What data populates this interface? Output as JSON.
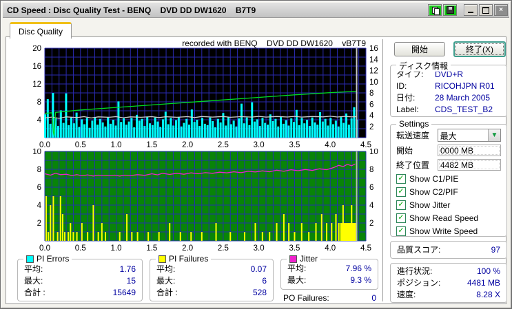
{
  "titlebar": {
    "title": "CD Speed : Disc Quality Test - BENQ    DVD DD DW1620    B7T9",
    "close_glyph": "×"
  },
  "tab": {
    "label": "Disc Quality"
  },
  "chart_header": {
    "recorded_with": "recorded with BENQ    DVD DD DW1620    vB7T9"
  },
  "buttons": {
    "start": "開始",
    "exit": "終了(X)"
  },
  "disc_info": {
    "title": "ディスク情報",
    "rows": [
      {
        "label": "タイプ:",
        "value": "DVD+R"
      },
      {
        "label": "ID:",
        "value": "RICOHJPN R01"
      },
      {
        "label": "日付:",
        "value": "28 March 2005"
      },
      {
        "label": "Label:",
        "value": "CDS_TEST_B2"
      }
    ]
  },
  "settings": {
    "title": "Settings",
    "speed_label": "転送速度",
    "speed_value": "最大",
    "start_label": "開始",
    "start_value": "0000 MB",
    "end_label": "終了位置",
    "end_value": "4482 MB",
    "checkboxes": [
      {
        "label": "Show C1/PIE",
        "checked": true
      },
      {
        "label": "Show C2/PIF",
        "checked": true
      },
      {
        "label": "Show Jitter",
        "checked": true
      },
      {
        "label": "Show Read Speed",
        "checked": true
      },
      {
        "label": "Show Write Speed",
        "checked": true
      }
    ],
    "check_glyph": "✓"
  },
  "quality": {
    "label": "品質スコア:",
    "value": "97"
  },
  "status": {
    "rows": [
      {
        "label": "進行状況:",
        "value": "100 %"
      },
      {
        "label": "ポジション:",
        "value": "4481  MB"
      },
      {
        "label": "速度:",
        "value": "8.28 X"
      }
    ]
  },
  "stats": {
    "pi_errors": {
      "title": "PI Errors",
      "swatch": "#00ffff",
      "rows": [
        {
          "label": "平均:",
          "value": "1.76"
        },
        {
          "label": "最大:",
          "value": "15"
        },
        {
          "label": "合計 :",
          "value": "15649"
        }
      ]
    },
    "pi_failures": {
      "title": "PI Failures",
      "swatch": "#ffff00",
      "rows": [
        {
          "label": "平均:",
          "value": "0.07"
        },
        {
          "label": "最大:",
          "value": "6"
        },
        {
          "label": "合計 :",
          "value": "528"
        }
      ]
    },
    "jitter": {
      "title": "Jitter",
      "swatch": "#ee22cc",
      "rows": [
        {
          "label": "平均:",
          "value": "7.96 %"
        },
        {
          "label": "最大:",
          "value": "9.3 %"
        }
      ]
    },
    "po_failures": {
      "label": "PO Failures:",
      "value": "0"
    }
  },
  "chart_data": [
    {
      "type": "area",
      "title": "PI Errors / speed (top graph)",
      "xlim": [
        0,
        4.5
      ],
      "x_ticks": [
        {
          "v": 0,
          "label": "0.0"
        },
        {
          "v": 0.5,
          "label": "0.5"
        },
        {
          "v": 1,
          "label": "1.0"
        },
        {
          "v": 1.5,
          "label": "1.5"
        },
        {
          "v": 2,
          "label": "2.0"
        },
        {
          "v": 2.5,
          "label": "2.5"
        },
        {
          "v": 3,
          "label": "3.0"
        },
        {
          "v": 3.5,
          "label": "3.5"
        },
        {
          "v": 4,
          "label": "4.0"
        },
        {
          "v": 4.5,
          "label": "4.5"
        }
      ],
      "left_ymax": 20,
      "left_ticks": [
        {
          "v": 20,
          "label": "20"
        },
        {
          "v": 16,
          "label": "16"
        },
        {
          "v": 12,
          "label": "12"
        },
        {
          "v": 8,
          "label": "8"
        },
        {
          "v": 4,
          "label": "4"
        }
      ],
      "right_ymax": 16,
      "right_ticks": [
        {
          "v": 16,
          "label": "16"
        },
        {
          "v": 14,
          "label": "14"
        },
        {
          "v": 12,
          "label": "12"
        },
        {
          "v": 10,
          "label": "10"
        },
        {
          "v": 8,
          "label": "8"
        },
        {
          "v": 6,
          "label": "6"
        },
        {
          "v": 4,
          "label": "4"
        },
        {
          "v": 2,
          "label": "2"
        }
      ],
      "grid_x_step": 0.1,
      "grid_y_step": 2,
      "bg": "#000000",
      "grid_color": "#2a2ab0",
      "cursor_x": 4.37,
      "cursor_color": "#c8c8c8",
      "series": [
        {
          "name": "pi-errors",
          "type": "bars-dense",
          "axis": "left",
          "color": "#00ffff",
          "x_step": 0.0367,
          "heights": [
            5.2,
            8.6,
            3.1,
            10,
            4.4,
            2.6,
            6.1,
            3.3,
            9.9,
            2.8,
            4.5,
            3.2,
            5.6,
            2.4,
            4.1,
            3.0,
            4.4,
            2.2,
            3.8,
            4.5,
            2.9,
            4.2,
            3.4,
            2.5,
            4.6,
            3.1,
            4.0,
            2.7,
            8.1,
            3.5,
            4.3,
            2.9,
            3.6,
            4.4,
            2.3,
            5.1,
            3.8,
            4.2,
            2.6,
            4.7,
            3.2,
            2.8,
            4.5,
            3.6,
            2.4,
            4.1,
            5.8,
            3.0,
            4.4,
            2.7,
            3.9,
            4.6,
            2.5,
            3.3,
            4.2,
            2.9,
            6.3,
            3.5,
            4.0,
            2.6,
            4.4,
            3.1,
            2.8,
            4.5,
            3.7,
            2.3,
            4.2,
            3.4,
            5.5,
            2.7,
            4.6,
            3.0,
            3.8,
            2.5,
            4.3,
            7.6,
            3.2,
            4.5,
            2.8,
            7.9,
            3.6,
            4.1,
            2.6,
            4.4,
            3.3,
            2.9,
            5.2,
            3.7,
            4.2,
            2.5,
            4.6,
            3.1,
            3.9,
            2.7,
            4.3,
            3.5,
            6.2,
            2.8,
            4.4,
            3.2,
            4.0,
            2.6,
            4.5,
            3.4,
            2.9,
            5.7,
            3.6,
            4.2,
            2.7,
            4.4,
            3.0,
            3.8,
            2.5,
            4.6,
            3.3,
            5.4,
            2.9,
            4.3,
            6.8,
            4.0
          ]
        },
        {
          "name": "write-speed",
          "type": "line",
          "axis": "left",
          "color": "#cfcfcf",
          "data": [
            [
              0,
              4.4
            ],
            [
              0.1,
              4.6
            ],
            [
              0.2,
              4.3
            ],
            [
              0.3,
              4.65
            ],
            [
              0.45,
              4.5
            ],
            [
              0.55,
              4.7
            ],
            [
              0.65,
              4.4
            ],
            [
              0.75,
              4.65
            ],
            [
              0.9,
              4.55
            ],
            [
              1.0,
              4.7
            ],
            [
              1.1,
              4.45
            ],
            [
              1.2,
              4.65
            ],
            [
              1.35,
              4.55
            ],
            [
              1.5,
              4.7
            ],
            [
              1.6,
              4.5
            ],
            [
              1.7,
              4.68
            ],
            [
              1.85,
              4.55
            ],
            [
              2.0,
              4.7
            ],
            [
              2.1,
              4.5
            ],
            [
              2.2,
              4.72
            ],
            [
              2.35,
              4.6
            ],
            [
              2.5,
              4.72
            ],
            [
              2.6,
              4.55
            ],
            [
              2.75,
              4.7
            ],
            [
              2.9,
              4.6
            ],
            [
              3.0,
              4.75
            ],
            [
              3.1,
              4.6
            ],
            [
              3.25,
              4.72
            ],
            [
              3.4,
              4.62
            ],
            [
              3.5,
              4.75
            ],
            [
              3.6,
              4.6
            ],
            [
              3.75,
              4.72
            ],
            [
              3.9,
              4.65
            ],
            [
              4.0,
              4.78
            ],
            [
              4.1,
              4.62
            ],
            [
              4.2,
              4.75
            ],
            [
              4.3,
              4.65
            ],
            [
              4.37,
              4.7
            ]
          ]
        },
        {
          "name": "read-speed",
          "type": "line",
          "axis": "right",
          "color": "#00dd22",
          "data": [
            [
              0,
              4.35
            ],
            [
              0.1,
              4.45
            ],
            [
              0.12,
              1.0
            ],
            [
              0.13,
              0.35
            ],
            [
              0.15,
              4.5
            ],
            [
              0.5,
              4.95
            ],
            [
              1.0,
              5.4
            ],
            [
              1.5,
              5.85
            ],
            [
              2.0,
              6.3
            ],
            [
              2.5,
              6.75
            ],
            [
              3.0,
              7.2
            ],
            [
              3.5,
              7.65
            ],
            [
              4.0,
              8.05
            ],
            [
              4.37,
              8.28
            ]
          ]
        }
      ]
    },
    {
      "type": "line",
      "title": "Jitter / PI Failures (bottom graph)",
      "xlim": [
        0,
        4.5
      ],
      "x_ticks": [
        {
          "v": 0,
          "label": "0.0"
        },
        {
          "v": 0.5,
          "label": "0.5"
        },
        {
          "v": 1,
          "label": "1.0"
        },
        {
          "v": 1.5,
          "label": "1.5"
        },
        {
          "v": 2,
          "label": "2.0"
        },
        {
          "v": 2.5,
          "label": "2.5"
        },
        {
          "v": 3,
          "label": "3.0"
        },
        {
          "v": 3.5,
          "label": "3.5"
        },
        {
          "v": 4,
          "label": "4.0"
        },
        {
          "v": 4.5,
          "label": "4.5"
        }
      ],
      "left_ymax": 10,
      "left_ticks": [
        {
          "v": 10,
          "label": "10"
        },
        {
          "v": 8,
          "label": "8"
        },
        {
          "v": 6,
          "label": "6"
        },
        {
          "v": 4,
          "label": "4"
        },
        {
          "v": 2,
          "label": "2"
        }
      ],
      "right_ymax": 10,
      "right_ticks": [
        {
          "v": 10,
          "label": "10"
        },
        {
          "v": 8,
          "label": "8"
        },
        {
          "v": 6,
          "label": "6"
        },
        {
          "v": 4,
          "label": "4"
        },
        {
          "v": 2,
          "label": "2"
        }
      ],
      "grid_x_step": 0.1,
      "grid_y_step": 1,
      "bg": "#088408",
      "grid_color": "#2233aa",
      "cursor_x": 4.37,
      "cursor_color": "#b8b8b8",
      "series": [
        {
          "name": "pi-failures",
          "type": "bars",
          "axis": "left",
          "color": "#ffff00",
          "data": [
            [
              0.02,
              5
            ],
            [
              0.05,
              1
            ],
            [
              0.08,
              4
            ],
            [
              0.12,
              5
            ],
            [
              0.18,
              1
            ],
            [
              0.22,
              5
            ],
            [
              0.25,
              3
            ],
            [
              0.28,
              1
            ],
            [
              0.33,
              1
            ],
            [
              0.36,
              2
            ],
            [
              0.4,
              1
            ],
            [
              0.45,
              1
            ],
            [
              0.52,
              2
            ],
            [
              0.6,
              1
            ],
            [
              0.68,
              4
            ],
            [
              0.75,
              1
            ],
            [
              0.8,
              2
            ],
            [
              0.85,
              1
            ],
            [
              1.05,
              1
            ],
            [
              1.15,
              3
            ],
            [
              1.22,
              1
            ],
            [
              1.3,
              1
            ],
            [
              1.45,
              1
            ],
            [
              1.6,
              1
            ],
            [
              1.75,
              2
            ],
            [
              1.9,
              1
            ],
            [
              2.05,
              1
            ],
            [
              2.2,
              1
            ],
            [
              2.4,
              2
            ],
            [
              2.6,
              1
            ],
            [
              2.8,
              1
            ],
            [
              2.95,
              2
            ],
            [
              3.05,
              1
            ],
            [
              3.15,
              1
            ],
            [
              3.25,
              2
            ],
            [
              3.35,
              3
            ],
            [
              3.42,
              2
            ],
            [
              3.5,
              1
            ],
            [
              3.6,
              2
            ],
            [
              3.7,
              1
            ],
            [
              3.8,
              2
            ],
            [
              3.88,
              3
            ],
            [
              3.95,
              2
            ],
            [
              4.02,
              2
            ],
            [
              4.08,
              3
            ],
            [
              4.12,
              2
            ],
            [
              4.18,
              4
            ],
            [
              4.3,
              4
            ]
          ]
        },
        {
          "name": "pi-failures-block",
          "type": "block",
          "axis": "left",
          "color": "#ffff00",
          "x1": 4.14,
          "x2": 4.36,
          "h": 2
        },
        {
          "name": "jitter",
          "type": "line",
          "axis": "left",
          "color": "#ee22cc",
          "data": [
            [
              0,
              7.5
            ],
            [
              0.08,
              7.35
            ],
            [
              0.15,
              7.55
            ],
            [
              0.22,
              7.4
            ],
            [
              0.3,
              7.45
            ],
            [
              0.38,
              7.3
            ],
            [
              0.45,
              7.4
            ],
            [
              0.52,
              7.28
            ],
            [
              0.6,
              7.38
            ],
            [
              0.68,
              7.25
            ],
            [
              0.75,
              7.35
            ],
            [
              0.82,
              7.3
            ],
            [
              0.9,
              7.28
            ],
            [
              0.98,
              7.35
            ],
            [
              1.05,
              7.25
            ],
            [
              1.12,
              7.35
            ],
            [
              1.2,
              7.3
            ],
            [
              1.3,
              7.4
            ],
            [
              1.4,
              7.32
            ],
            [
              1.5,
              7.5
            ],
            [
              1.58,
              7.38
            ],
            [
              1.65,
              7.55
            ],
            [
              1.75,
              7.42
            ],
            [
              1.85,
              7.55
            ],
            [
              1.95,
              7.45
            ],
            [
              2.05,
              7.6
            ],
            [
              2.15,
              7.5
            ],
            [
              2.25,
              7.62
            ],
            [
              2.35,
              7.55
            ],
            [
              2.45,
              7.68
            ],
            [
              2.55,
              7.6
            ],
            [
              2.65,
              7.72
            ],
            [
              2.75,
              7.62
            ],
            [
              2.85,
              7.78
            ],
            [
              2.95,
              7.7
            ],
            [
              3.05,
              7.82
            ],
            [
              3.15,
              7.72
            ],
            [
              3.25,
              7.9
            ],
            [
              3.35,
              7.78
            ],
            [
              3.45,
              7.95
            ],
            [
              3.55,
              7.85
            ],
            [
              3.65,
              7.98
            ],
            [
              3.75,
              7.88
            ],
            [
              3.85,
              8.05
            ],
            [
              3.95,
              7.95
            ],
            [
              4.05,
              8.2
            ],
            [
              4.12,
              8.45
            ],
            [
              4.18,
              8.3
            ],
            [
              4.24,
              8.55
            ],
            [
              4.3,
              8.4
            ],
            [
              4.35,
              8.6
            ]
          ]
        }
      ]
    }
  ]
}
